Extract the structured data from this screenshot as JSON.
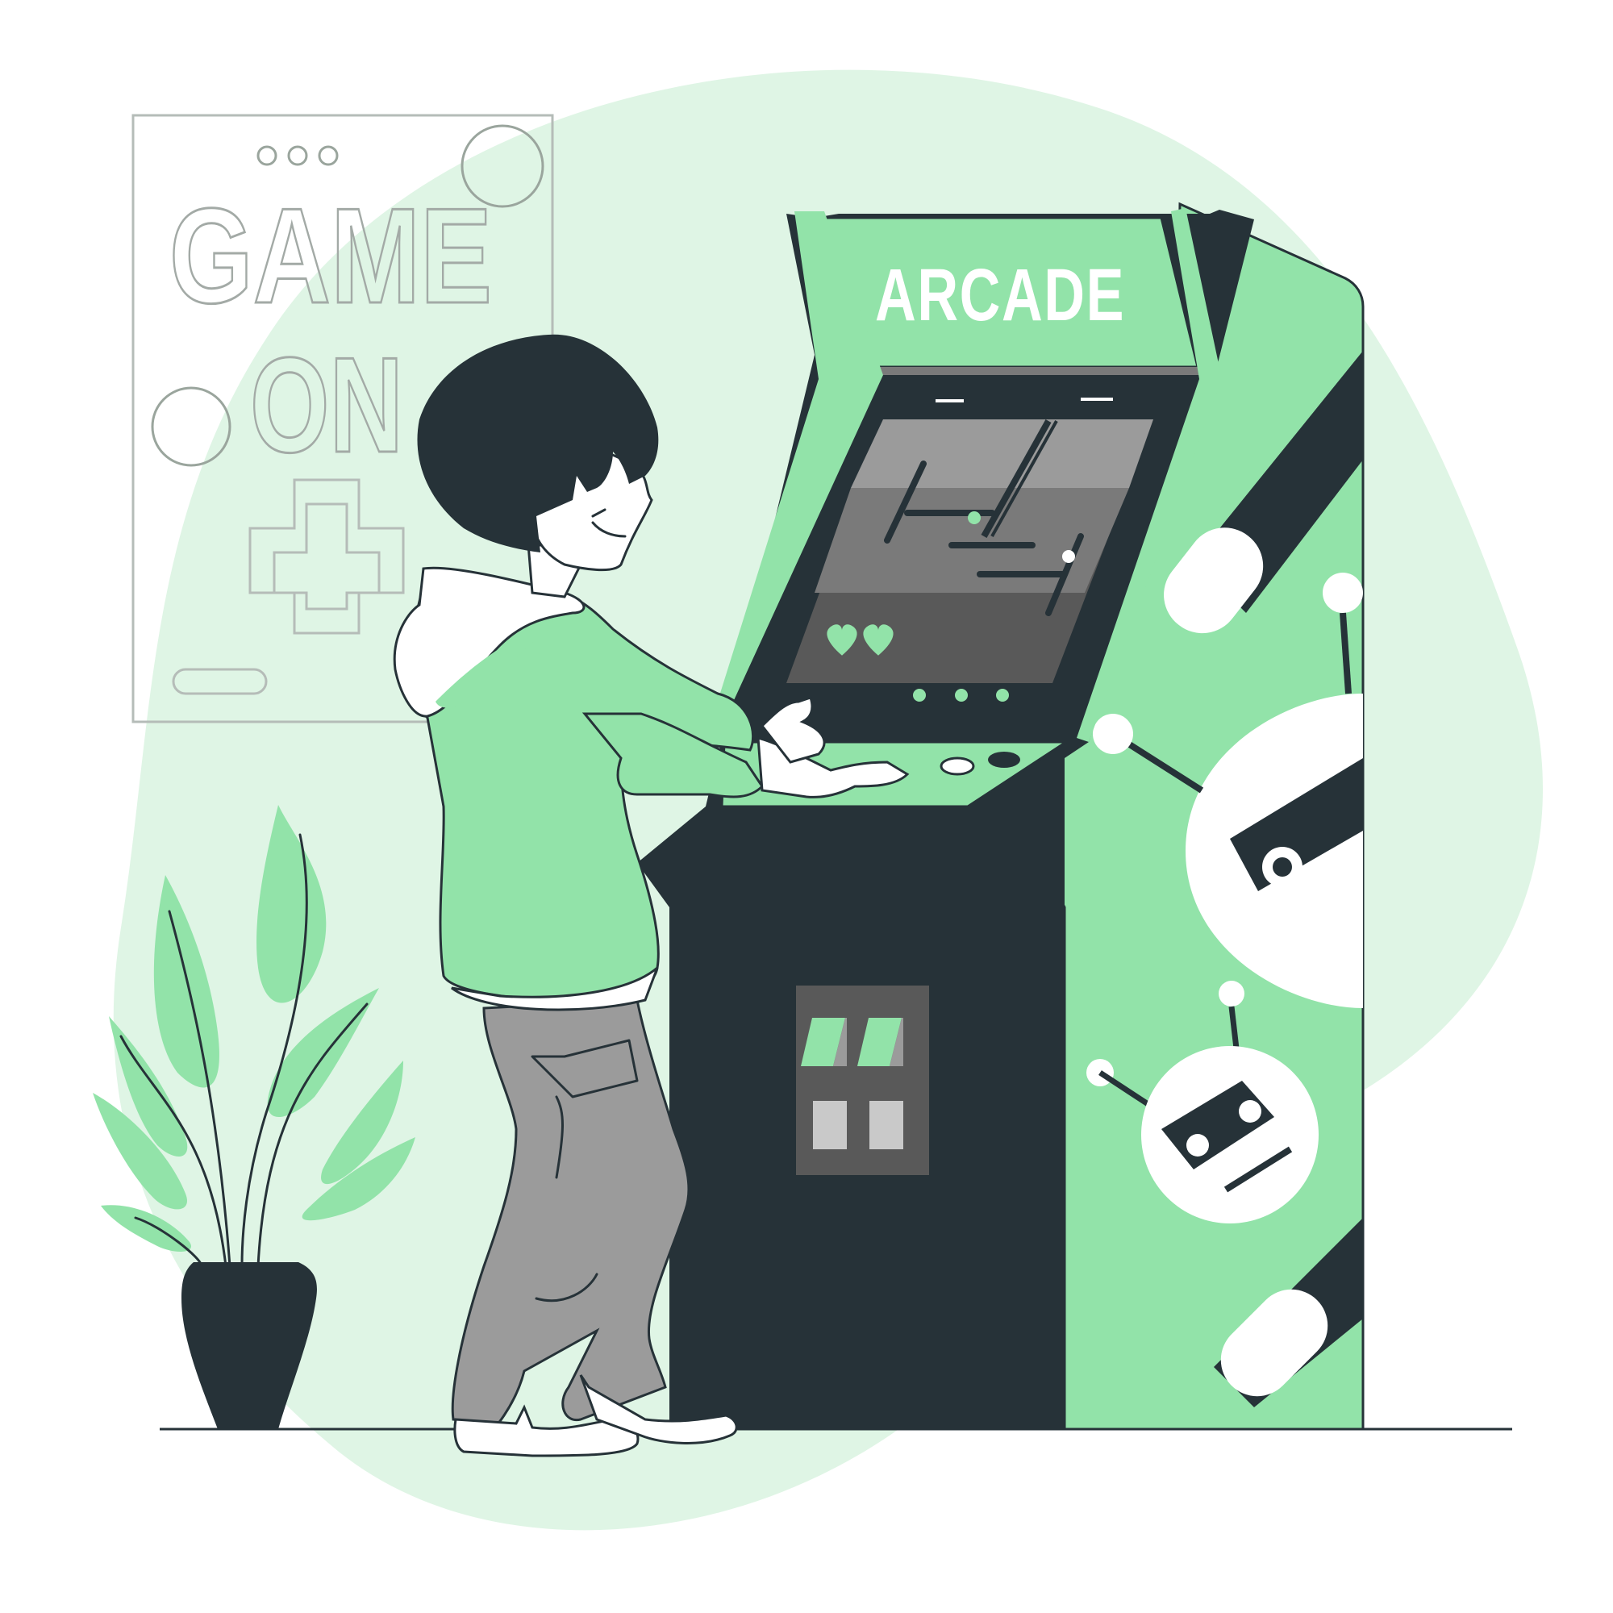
{
  "scene": {
    "marquee_label": "ARCADE",
    "poster_line1": "GAME",
    "poster_line2": "ON"
  },
  "colors": {
    "accent_green": "#92e3a9",
    "light_green_bg": "#dff5e5",
    "dark": "#263238",
    "screen_gray": "#7a7a7a",
    "pants_gray": "#9a9a9a"
  },
  "icons": [
    "heart-icon",
    "plus-icon",
    "robot-icon"
  ]
}
